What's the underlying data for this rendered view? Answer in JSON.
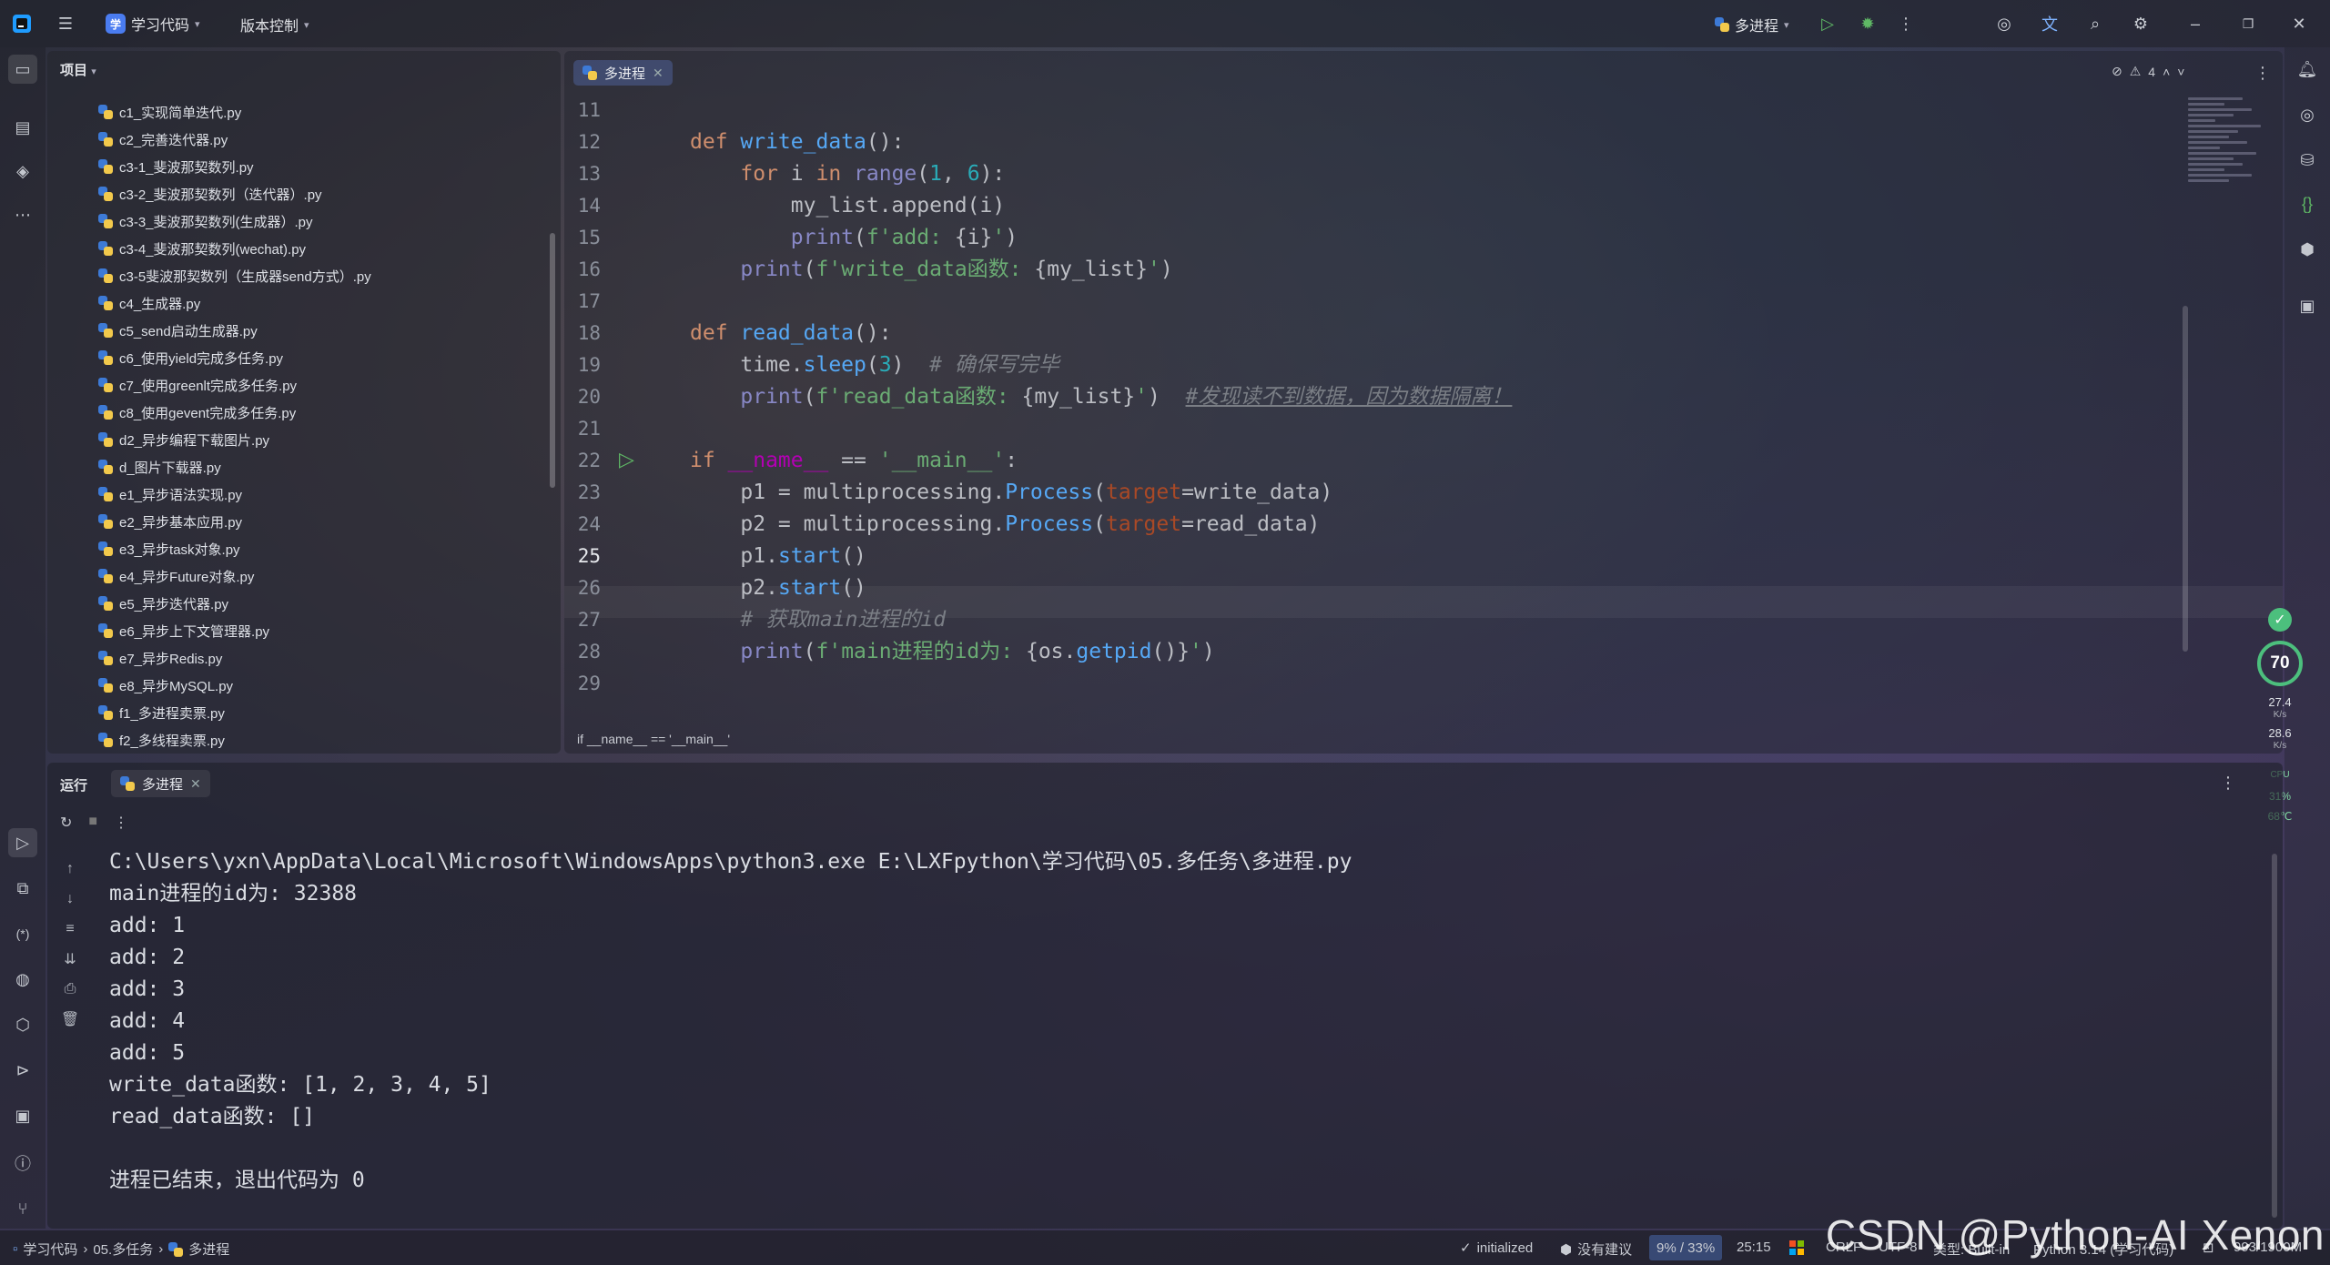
{
  "titlebar": {
    "project_badge": "学",
    "project_name": "学习代码",
    "vcs_label": "版本控制",
    "run_config": "多进程"
  },
  "project_panel": {
    "title": "项目",
    "files": [
      "c1_实现简单迭代.py",
      "c2_完善迭代器.py",
      "c3-1_斐波那契数列.py",
      "c3-2_斐波那契数列（迭代器）.py",
      "c3-3_斐波那契数列(生成器）.py",
      "c3-4_斐波那契数列(wechat).py",
      "c3-5斐波那契数列（生成器send方式）.py",
      "c4_生成器.py",
      "c5_send启动生成器.py",
      "c6_使用yield完成多任务.py",
      "c7_使用greenlt完成多任务.py",
      "c8_使用gevent完成多任务.py",
      "d2_异步编程下载图片.py",
      "d_图片下载器.py",
      "e1_异步语法实现.py",
      "e2_异步基本应用.py",
      "e3_异步task对象.py",
      "e4_异步Future对象.py",
      "e5_异步迭代器.py",
      "e6_异步上下文管理器.py",
      "e7_异步Redis.py",
      "e8_异步MySQL.py",
      "f1_多进程卖票.py",
      "f2_多线程卖票.py"
    ]
  },
  "editor": {
    "tab_name": "多进程",
    "warning_count": "4",
    "line_numbers": [
      "11",
      "12",
      "13",
      "14",
      "15",
      "16",
      "17",
      "18",
      "19",
      "20",
      "21",
      "22",
      "23",
      "24",
      "25",
      "26",
      "27",
      "28",
      "29"
    ],
    "current_line": "25",
    "breadcrumb": "if __name__ == '__main__'"
  },
  "monitor": {
    "score": "70",
    "upload": "27.4",
    "upload_unit": "K/s",
    "download": "28.6",
    "download_unit": "K/s",
    "cpu_label": "CPU",
    "cpu_value": "31%",
    "temp": "68℃"
  },
  "run_panel": {
    "title": "运行",
    "tab_name": "多进程",
    "output": [
      "C:\\Users\\yxn\\AppData\\Local\\Microsoft\\WindowsApps\\python3.exe E:\\LXFpython\\学习代码\\05.多任务\\多进程.py",
      "main进程的id为: 32388",
      "add: 1",
      "add: 2",
      "add: 3",
      "add: 4",
      "add: 5",
      "write_data函数: [1, 2, 3, 4, 5]",
      "read_data函数: []",
      "",
      "进程已结束，退出代码为 0"
    ]
  },
  "statusbar": {
    "crumb_root": "学习代码",
    "crumb_folder": "05.多任务",
    "crumb_file": "多进程",
    "initialized": "initialized",
    "no_suggestion": "没有建议",
    "memory": "9% / 33%",
    "position": "25:15",
    "line_sep": "CRLF",
    "encoding": "UTF-8",
    "type": "类型: Built-in",
    "interpreter": "Python 3.14 (学习代码)",
    "heap": "993/1900M"
  },
  "watermark": "CSDN @Python-AI Xenon",
  "colors": {
    "keyword": "#cf8e6d",
    "function": "#56a8f5",
    "string": "#6aab73",
    "number": "#2aacb8",
    "comment": "#7a7e85",
    "run_green": "#5fb865"
  }
}
